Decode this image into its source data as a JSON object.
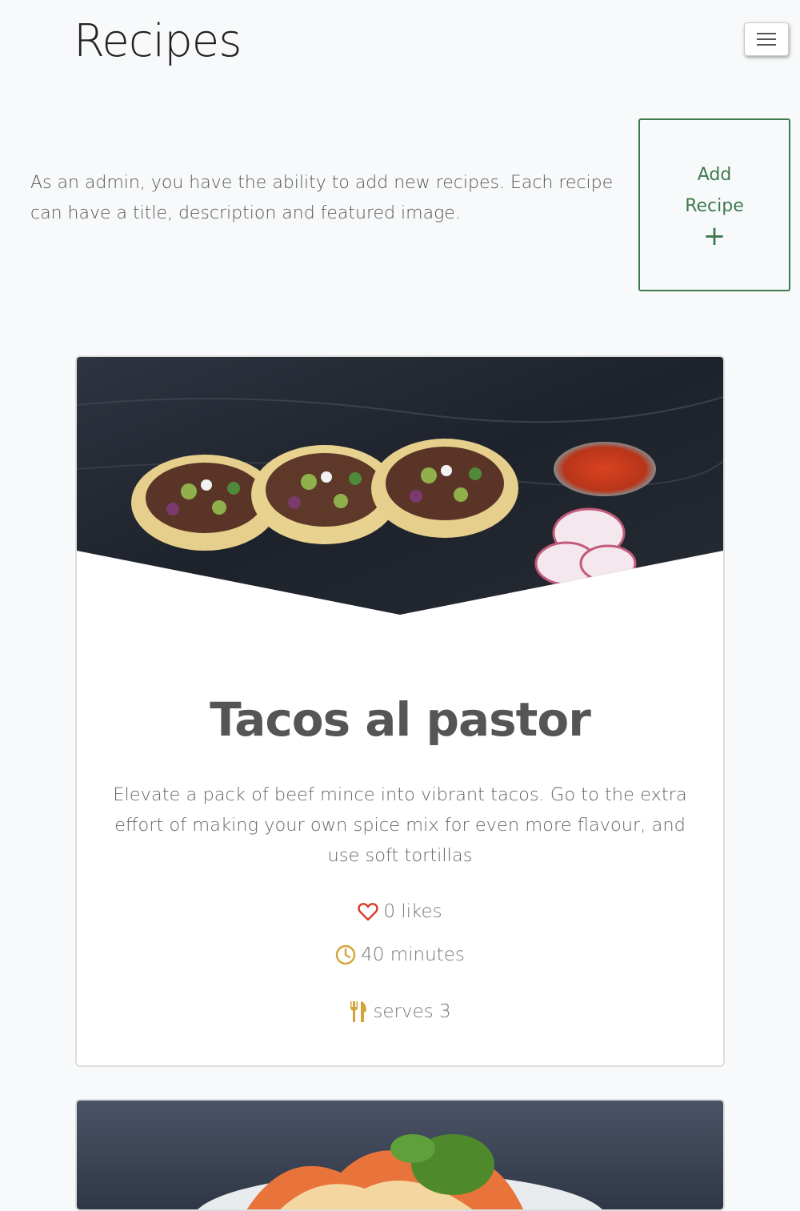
{
  "header": {
    "title": "Recipes"
  },
  "intro": {
    "text": "As an admin, you have the ability to add new recipes. Each recipe can have a title, description and featured image."
  },
  "add_button": {
    "line1": "Add",
    "line2": "Recipe",
    "plus": "+"
  },
  "recipes": [
    {
      "title": "Tacos al pastor",
      "description": "Elevate a pack of beef mince into vibrant tacos. Go to the extra effort of making your own spice mix for even more flavour, and use soft tortillas",
      "likes": "0 likes",
      "time": "40 minutes",
      "serves": "serves 3"
    }
  ],
  "icons": {
    "menu": "hamburger-menu-icon",
    "likes": "heart-icon",
    "time": "clock-icon",
    "serves": "fork-knife-icon"
  },
  "colors": {
    "accent_green": "#3d7a4f",
    "heart_red": "#d9372b",
    "icon_gold": "#d6a23a",
    "background": "#f8f9fa"
  }
}
